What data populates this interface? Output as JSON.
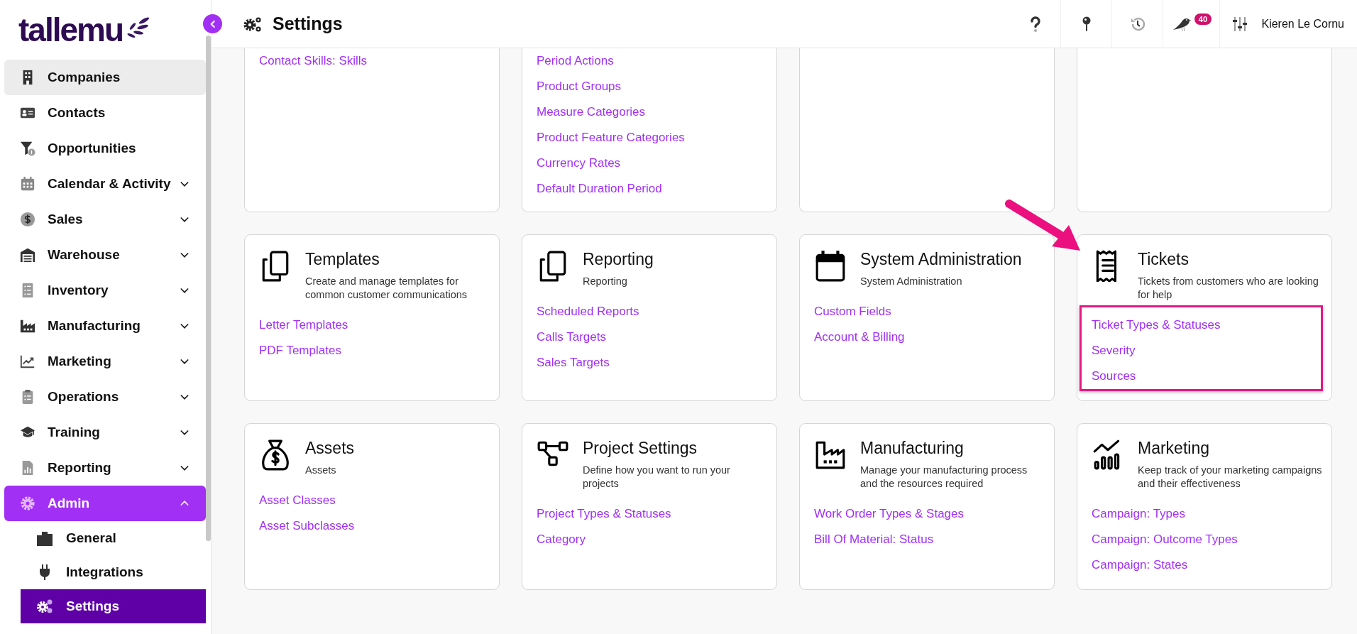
{
  "sidebar": {
    "logo": "tallemu",
    "items": [
      {
        "label": "Companies",
        "hovered": true,
        "selected": false
      },
      {
        "label": "Contacts",
        "selected": false
      },
      {
        "label": "Opportunities",
        "selected": false
      },
      {
        "label": "Calendar & Activity",
        "selected": false,
        "expanded": false
      },
      {
        "label": "Sales",
        "selected": false,
        "expanded": false
      },
      {
        "label": "Warehouse",
        "selected": false,
        "expanded": false
      },
      {
        "label": "Inventory",
        "selected": false,
        "expanded": false
      },
      {
        "label": "Manufacturing",
        "selected": false,
        "expanded": false
      },
      {
        "label": "Marketing",
        "selected": false,
        "expanded": false
      },
      {
        "label": "Operations",
        "selected": false,
        "expanded": false
      },
      {
        "label": "Training",
        "selected": false,
        "expanded": false
      },
      {
        "label": "Reporting",
        "selected": false,
        "expanded": false
      },
      {
        "label": "Admin",
        "selected": true,
        "expanded": true,
        "children": [
          {
            "label": "General",
            "selected": false
          },
          {
            "label": "Integrations",
            "selected": false
          },
          {
            "label": "Settings",
            "selected": true
          }
        ]
      }
    ]
  },
  "topbar": {
    "title": "Settings",
    "notification_count": "40",
    "user_name": "Kieren Le Cornu"
  },
  "cards": [
    {
      "cut_off": true,
      "highlighted": false,
      "links": [
        "Contact Skills: Skills"
      ]
    },
    {
      "cut_off": true,
      "highlighted": false,
      "links": [
        "Period Actions",
        "Product Groups",
        "Measure Categories",
        "Product Feature Categories",
        "Currency Rates",
        "Default Duration Period"
      ]
    },
    {
      "cut_off": true,
      "highlighted": false
    },
    {
      "cut_off": true,
      "highlighted": false
    },
    {
      "cut_off": false,
      "highlighted": false,
      "title": "Templates",
      "description": "Create and manage templates for common customer communications",
      "links": [
        "Letter Templates",
        "PDF Templates"
      ]
    },
    {
      "cut_off": false,
      "highlighted": false,
      "title": "Reporting",
      "description": "Reporting",
      "links": [
        "Scheduled Reports",
        "Calls Targets",
        "Sales Targets"
      ]
    },
    {
      "cut_off": false,
      "highlighted": false,
      "title": "System Administration",
      "description": "System Administration",
      "links": [
        "Custom Fields",
        "Account & Billing"
      ]
    },
    {
      "cut_off": false,
      "highlighted": true,
      "title": "Tickets",
      "description": "Tickets from customers who are looking for help",
      "links": [
        "Ticket Types & Statuses",
        "Severity",
        "Sources"
      ]
    },
    {
      "cut_off": false,
      "highlighted": false,
      "title": "Assets",
      "description": "Assets",
      "links": [
        "Asset Classes",
        "Asset Subclasses"
      ]
    },
    {
      "cut_off": false,
      "highlighted": false,
      "title": "Project Settings",
      "description": "Define how you want to run your projects",
      "links": [
        "Project Types & Statuses",
        "Category"
      ]
    },
    {
      "cut_off": false,
      "highlighted": false,
      "title": "Manufacturing",
      "description": "Manage your manufacturing process and the resources required",
      "links": [
        "Work Order Types & Stages",
        "Bill Of Material: Status"
      ]
    },
    {
      "cut_off": false,
      "highlighted": false,
      "title": "Marketing",
      "description": "Keep track of your marketing campaigns and their effectiveness",
      "links": [
        "Campaign: Types",
        "Campaign: Outcome Types",
        "Campaign: States"
      ]
    }
  ]
}
